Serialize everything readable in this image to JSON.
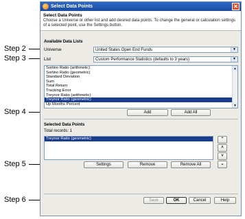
{
  "callouts": [
    {
      "label": "Step 2"
    },
    {
      "label": "Step 3"
    },
    {
      "label": "Step 4"
    },
    {
      "label": "Step 5"
    },
    {
      "label": "Step 6"
    }
  ],
  "dialog": {
    "title": "Select Data Points",
    "close_glyph": "✕",
    "header_title": "Select Data Points",
    "header_desc": "Choose a Universe or other list and add desired data points. To change the general or calculation settings of a selected point, use the Settings button."
  },
  "available": {
    "section_title": "Available Data Lists",
    "universe_label": "Universe",
    "universe_value": "United States Open End Funds",
    "list_label": "List",
    "list_value": "Custom Performance Statistics (defaults to 3 years)",
    "items": [
      {
        "text": "Sortino Ratio (arithmetic)"
      },
      {
        "text": "Sortino Ratio (geometric)"
      },
      {
        "text": "Standard Deviation"
      },
      {
        "text": "Sum"
      },
      {
        "text": "Total Return"
      },
      {
        "text": "Tracking Error"
      },
      {
        "text": "Treynor Ratio (arithmetic)"
      },
      {
        "text": "Treynor Ratio (geometric)"
      },
      {
        "text": "Up Months Percent"
      }
    ],
    "selected_index": 7,
    "add_label": "Add",
    "add_all_label": "Add All"
  },
  "selected": {
    "section_title": "Selected Data Points",
    "total_records": "Total records: 1",
    "items": [
      {
        "text": "Treynor Ratio (geometric)"
      }
    ],
    "move_top_glyph": "⌃",
    "move_up_glyph": "˄",
    "move_down_glyph": "˅",
    "move_bottom_glyph": "⌄",
    "settings_label": "Settings",
    "remove_label": "Remove",
    "remove_all_label": "Remove All"
  },
  "footer": {
    "save_label": "Save",
    "ok_label": "OK",
    "cancel_label": "Cancel",
    "help_label": "Help"
  }
}
